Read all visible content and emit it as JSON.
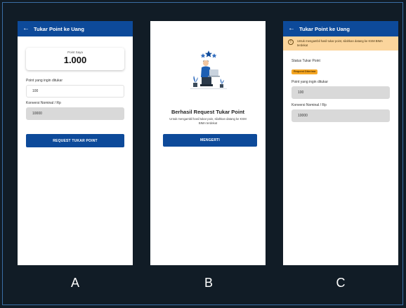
{
  "captions": {
    "a": "A",
    "b": "B",
    "c": "C"
  },
  "screen_a": {
    "appbar_title": "Tukar Point ke Uang",
    "balance_label": "Point Saya",
    "balance_value": "1.000",
    "point_label": "Point yang ingin ditukar",
    "point_value": "100",
    "conversion_label": "Konversi Nominal / Rp",
    "conversion_value": "10000",
    "button_label": "REQUEST TUKAR POINT"
  },
  "screen_b": {
    "title": "Berhasil Request Tukar Point",
    "description": "Untuk mengambil hasil tukar poin, silahkan datang ke KSM BIMA terdekat",
    "button_label": "MENGERTI"
  },
  "screen_c": {
    "appbar_title": "Tukar Point ke Uang",
    "alert_text": "Untuk mengambil hasil tukar point, silahkan datang ke KSM BIMA terdekat",
    "status_label": "Status Tukar Point",
    "status_value": "Request Diterima",
    "point_label": "Point yang ingin ditukar",
    "point_value": "100",
    "conversion_label": "Konversi Nominal / Rp",
    "conversion_value": "10000"
  },
  "colors": {
    "primary": "#0d4a9a",
    "background": "#111c26",
    "frame_border": "#3a6ea5",
    "alert_bg": "#fbd59c",
    "badge": "#f5a623"
  },
  "icons": {
    "back": "arrow-left-icon",
    "alert": "info-icon",
    "illustration": "person-laptop-illustration"
  }
}
